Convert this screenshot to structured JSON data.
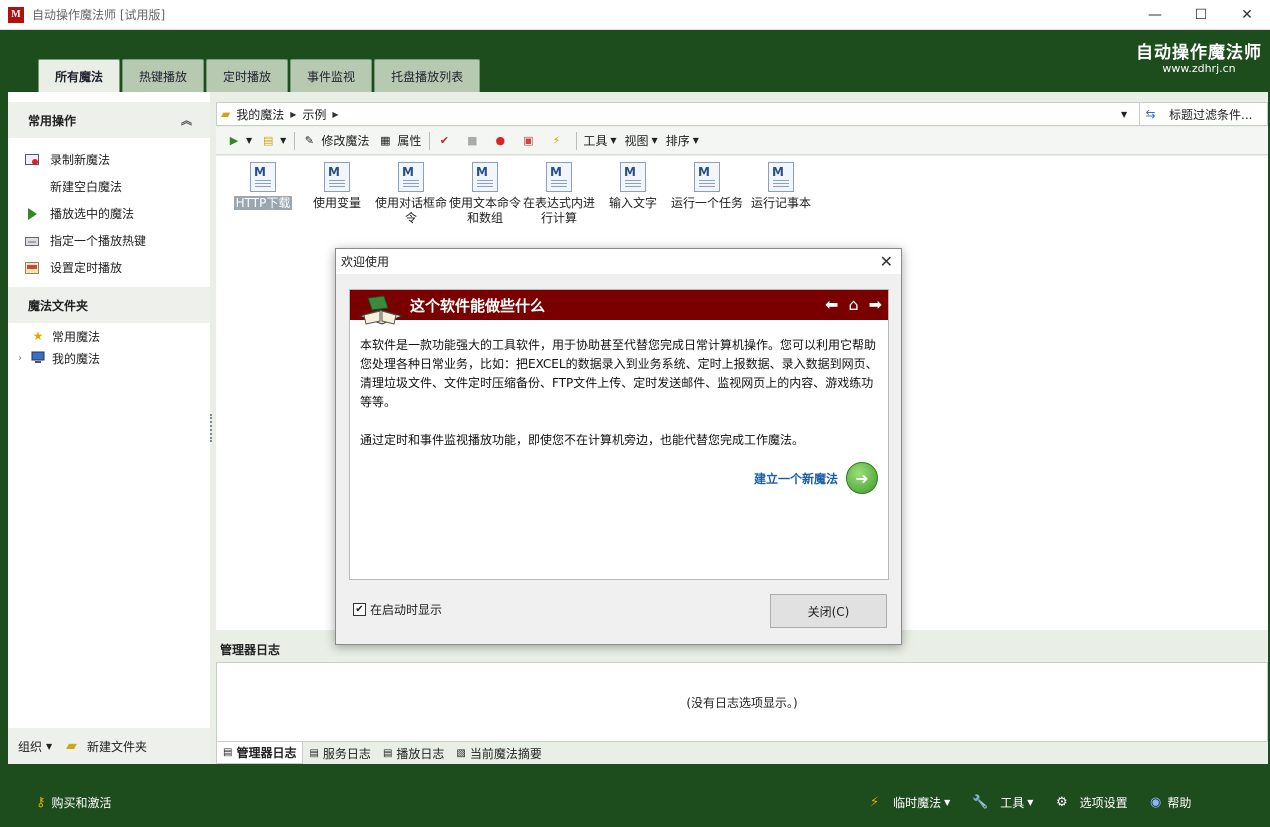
{
  "window": {
    "app_icon_text": "M",
    "title": "自动操作魔法师 [试用版]",
    "minimize_glyph": "—",
    "maximize_glyph": "☐",
    "close_glyph": "✕"
  },
  "brand": {
    "name": "自动操作魔法师",
    "url": "www.zdhrj.cn"
  },
  "tabs": [
    {
      "label": "所有魔法",
      "active": true
    },
    {
      "label": "热键播放",
      "active": false
    },
    {
      "label": "定时播放",
      "active": false
    },
    {
      "label": "事件监视",
      "active": false
    },
    {
      "label": "托盘播放列表",
      "active": false
    }
  ],
  "sidebar": {
    "common_ops_title": "常用操作",
    "collapse_glyph": "︽",
    "ops": [
      {
        "label": "录制新魔法",
        "icon": "record-icon"
      },
      {
        "label": "新建空白魔法",
        "icon": ""
      },
      {
        "label": "播放选中的魔法",
        "icon": "play-icon"
      },
      {
        "label": "指定一个播放热键",
        "icon": "keyboard-icon"
      },
      {
        "label": "设置定时播放",
        "icon": "timer-icon"
      }
    ],
    "folders_title": "魔法文件夹",
    "folders": [
      {
        "label": "常用魔法",
        "icon": "star-icon",
        "expandable": false
      },
      {
        "label": "我的魔法",
        "icon": "computer-folder-icon",
        "expandable": true
      }
    ],
    "organize_label": "组织",
    "new_folder_label": "新建文件夹"
  },
  "address": {
    "segments": [
      "我的魔法",
      "示例"
    ],
    "filter_label": "标题过滤条件..."
  },
  "toolbar": {
    "edit_label": "修改魔法",
    "props_label": "属性",
    "tools_label": "工具",
    "view_label": "视图",
    "sort_label": "排序"
  },
  "files": [
    {
      "label": "HTTP下载",
      "selected": true
    },
    {
      "label": "使用变量",
      "selected": false
    },
    {
      "label": "使用对话框命令",
      "selected": false
    },
    {
      "label": "使用文本命令和数组",
      "selected": false
    },
    {
      "label": "在表达式内进行计算",
      "selected": false
    },
    {
      "label": "输入文字",
      "selected": false
    },
    {
      "label": "运行一个任务",
      "selected": false
    },
    {
      "label": "运行记事本",
      "selected": false
    }
  ],
  "log": {
    "title": "管理器日志",
    "empty_text": "(没有日志选项显示。)",
    "tabs": [
      {
        "label": "管理器日志",
        "active": true
      },
      {
        "label": "服务日志",
        "active": false
      },
      {
        "label": "播放日志",
        "active": false
      },
      {
        "label": "当前魔法摘要",
        "active": false
      }
    ]
  },
  "statusbar": {
    "buy_label": "购买和激活",
    "temp_magic_label": "临时魔法",
    "tools_label": "工具",
    "options_label": "选项设置",
    "help_label": "帮助"
  },
  "dialog": {
    "title": "欢迎使用",
    "banner_title": "这个软件能做些什么",
    "paragraph1": "本软件是一款功能强大的工具软件，用于协助甚至代替您完成日常计算机操作。您可以利用它帮助您处理各种日常业务，比如：把EXCEL的数据录入到业务系统、定时上报数据、录入数据到网页、清理垃圾文件、文件定时压缩备份、FTP文件上传、定时发送邮件、监视网页上的内容、游戏练功等等。",
    "paragraph2": "通过定时和事件监视播放功能，即使您不在计算机旁边，也能代替您完成工作魔法。",
    "new_magic_link": "建立一个新魔法",
    "show_on_startup_label": "在启动时显示",
    "show_on_startup": true,
    "close_button": "关闭(C)"
  }
}
